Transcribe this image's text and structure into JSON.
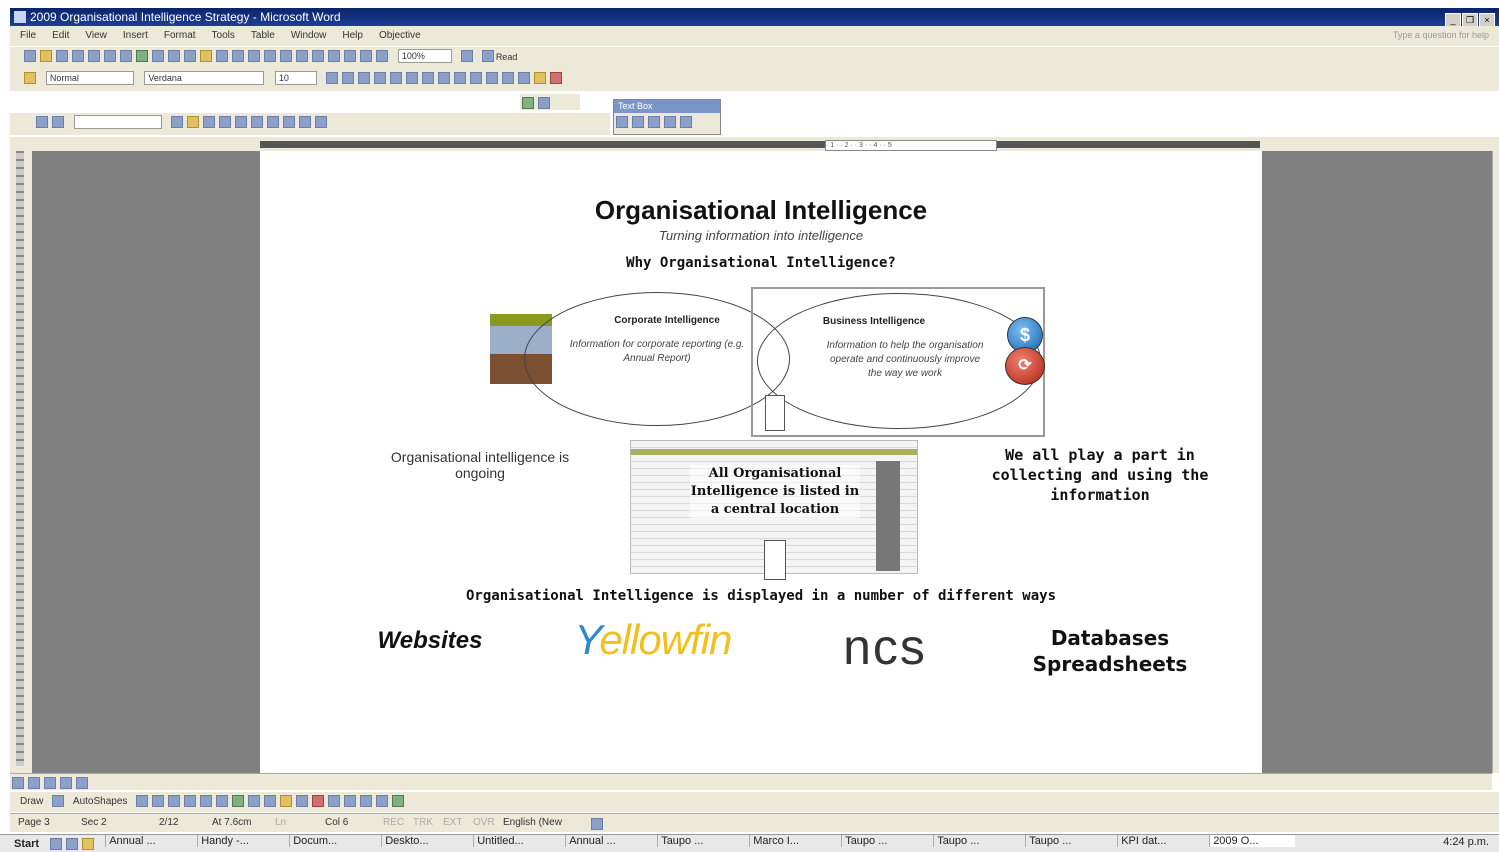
{
  "window": {
    "title": "2009 Organisational Intelligence Strategy - Microsoft Word"
  },
  "menu": {
    "items": [
      "File",
      "Edit",
      "View",
      "Insert",
      "Format",
      "Tools",
      "Table",
      "Window",
      "Help",
      "Objective"
    ],
    "help_placeholder": "Type a question for help"
  },
  "toolbar": {
    "zoom": "100%",
    "read_label": "Read",
    "style": "Normal",
    "font": "Verdana",
    "size": "10",
    "textbox_title": "Text Box"
  },
  "document": {
    "title": "Organisational Intelligence",
    "subtitle": "Turning information into intelligence",
    "why": "Why Organisational Intelligence?",
    "corporate": {
      "title": "Corporate Intelligence",
      "text": "Information for corporate reporting (e.g. Annual Report)"
    },
    "business": {
      "title": "Business Intelligence",
      "text": "Information to help the organisation operate and continuously improve the way we work"
    },
    "ongoing": "Organisational intelligence is ongoing",
    "central": "All Organisational Intelligence is listed in a central location",
    "play_part": "We all play a part in collecting and using the information",
    "displayed": "Organisational Intelligence is displayed in a number of different ways",
    "ways": {
      "websites": "Websites",
      "yellowfin_y": "Y",
      "yellowfin_rest": "ellowfin",
      "ncs": "ncs",
      "databases": "Databases",
      "spreadsheets": "Spreadsheets"
    }
  },
  "drawbar": {
    "draw": "Draw",
    "autoshapes": "AutoShapes"
  },
  "status": {
    "page": "Page 3",
    "sec": "Sec 2",
    "pages": "2/12",
    "at": "At 7.6cm",
    "ln": "Ln",
    "col": "Col 6",
    "rec": "REC",
    "trk": "TRK",
    "ext": "EXT",
    "ovr": "OVR",
    "language": "English (New"
  },
  "taskbar": {
    "start": "Start",
    "tasks": [
      "Annual ...",
      "Handy -...",
      "Docum...",
      "Deskto...",
      "Untitled...",
      "Annual ...",
      "Taupo ...",
      "Marco I...",
      "Taupo ...",
      "Taupo ...",
      "Taupo ...",
      "KPI dat...",
      "2009 O..."
    ],
    "clock": "4:24 p.m."
  },
  "colors": {
    "titlebar": "#0a246a",
    "chrome": "#ece9d8",
    "workspace": "#808080",
    "yellowfin": "#f0c020",
    "yellowfin_y": "#2a8ad0"
  }
}
